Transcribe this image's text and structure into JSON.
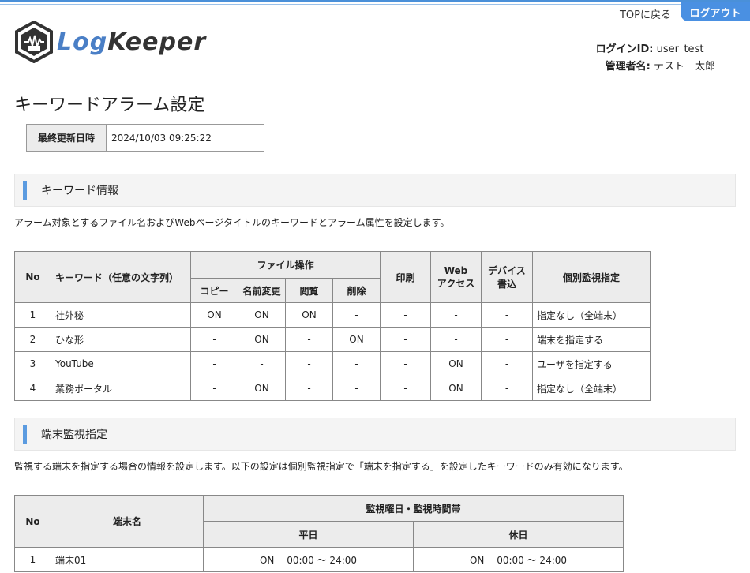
{
  "header": {
    "top_link": "TOPに戻る",
    "logout": "ログアウト",
    "logo_prefix": "Log",
    "logo_suffix": "Keeper",
    "login_id_label": "ログインID:",
    "login_id": "user_test",
    "admin_label": "管理者名:",
    "admin_name": "テスト　太郎"
  },
  "page_title": "キーワードアラーム設定",
  "updated": {
    "label": "最終更新日時",
    "value": "2024/10/03 09:25:22"
  },
  "keyword_section": {
    "title": "キーワード情報",
    "description": "アラーム対象とするファイル名およびWebページタイトルのキーワードとアラーム属性を設定します。",
    "headers": {
      "no": "No",
      "keyword": "キーワード（任意の文字列）",
      "file_ops": "ファイル操作",
      "copy": "コピー",
      "rename": "名前変更",
      "view": "閲覧",
      "delete": "削除",
      "print": "印刷",
      "web1": "Web",
      "web2": "アクセス",
      "device1": "デバイス",
      "device2": "書込",
      "monitor": "個別監視指定"
    },
    "rows": [
      {
        "no": "1",
        "keyword": "社外秘",
        "copy": "ON",
        "rename": "ON",
        "view": "ON",
        "delete": "-",
        "print": "-",
        "web": "-",
        "device": "-",
        "monitor": "指定なし（全端末）"
      },
      {
        "no": "2",
        "keyword": "ひな形",
        "copy": "-",
        "rename": "ON",
        "view": "-",
        "delete": "ON",
        "print": "-",
        "web": "-",
        "device": "-",
        "monitor": "端末を指定する"
      },
      {
        "no": "3",
        "keyword": "YouTube",
        "copy": "-",
        "rename": "-",
        "view": "-",
        "delete": "-",
        "print": "-",
        "web": "ON",
        "device": "-",
        "monitor": "ユーザを指定する"
      },
      {
        "no": "4",
        "keyword": "業務ポータル",
        "copy": "-",
        "rename": "ON",
        "view": "-",
        "delete": "-",
        "print": "-",
        "web": "ON",
        "device": "-",
        "monitor": "指定なし（全端末）"
      }
    ]
  },
  "terminal_section": {
    "title": "端末監視指定",
    "description": "監視する端末を指定する場合の情報を設定します。以下の設定は個別監視指定で「端末を指定する」を設定したキーワードのみ有効になります。",
    "headers": {
      "no": "No",
      "terminal": "端末名",
      "schedule": "監視曜日・監視時間帯",
      "weekday": "平日",
      "holiday": "休日"
    },
    "rows": [
      {
        "no": "1",
        "terminal": "端末01",
        "weekday": "ON　 00:00 〜 24:00",
        "holiday": "ON　 00:00 〜 24:00"
      }
    ]
  },
  "colors": {
    "accent": "#4a90e2",
    "section_bar": "#5b9be0",
    "header_bg": "#ececec"
  }
}
